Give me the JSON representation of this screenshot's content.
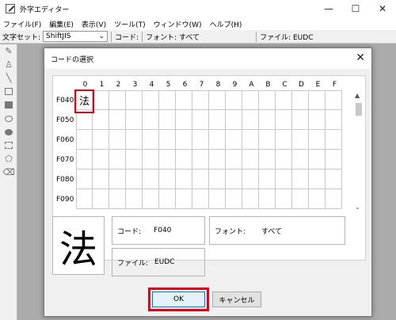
{
  "app": {
    "title": "外字エディター",
    "controls": {
      "minimize": "—",
      "maximize": "☐",
      "close": "✕"
    }
  },
  "menu": [
    "ファイル(F)",
    "編集(E)",
    "表示(V)",
    "ツール(T)",
    "ウィンドウ(W)",
    "ヘルプ(H)"
  ],
  "toolbar": {
    "charset_label": "文字セット:",
    "charset_value": "ShiftJIS",
    "code_label": "コード:",
    "font_label": "フォント: すべて",
    "file_label": "ファイル: EUDC"
  },
  "tools": [
    "pencil-icon",
    "brush-icon",
    "line-icon",
    "rect-icon",
    "filled-rect-icon",
    "ellipse-icon",
    "filled-ellipse-icon",
    "select-rect-icon",
    "freeform-select-icon",
    "eraser-icon"
  ],
  "dialog": {
    "title": "コードの選択",
    "close": "✕",
    "columns": [
      "0",
      "1",
      "2",
      "3",
      "4",
      "5",
      "6",
      "7",
      "8",
      "9",
      "A",
      "B",
      "C",
      "D",
      "E",
      "F"
    ],
    "rows": [
      "F040",
      "F050",
      "F060",
      "F070",
      "F080",
      "F090"
    ],
    "selected_cell_char": "法",
    "preview_char": "法",
    "code_key": "コード:",
    "code_val": "F040",
    "font_key": "フォント:",
    "font_val": "すべて",
    "file_key": "ファイル:",
    "file_val": "EUDC",
    "ok": "OK",
    "cancel": "キャンセル"
  },
  "colors": {
    "highlight": "#e60012",
    "accent": "#0078d7"
  }
}
